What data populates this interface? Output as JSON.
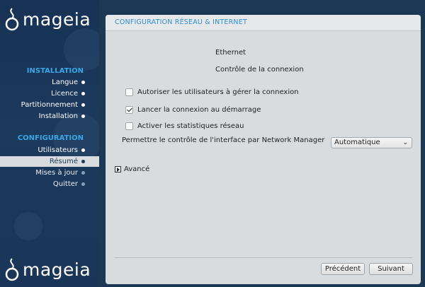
{
  "brand": {
    "name": "mageia"
  },
  "sidebar": {
    "installation_header": "INSTALLATION",
    "installation_items": [
      {
        "label": "Langue"
      },
      {
        "label": "Licence"
      },
      {
        "label": "Partitionnement"
      },
      {
        "label": "Installation"
      }
    ],
    "configuration_header": "CONFIGURATION",
    "configuration_items": [
      {
        "label": "Utilisateurs"
      },
      {
        "label": "Résumé",
        "current": true
      },
      {
        "label": "Mises à jour"
      },
      {
        "label": "Quitter"
      }
    ]
  },
  "panel": {
    "title": "CONFIGURATION RÉSEAU & INTERNET",
    "interface_name": "Ethernet",
    "section_label": "Contrôle de la connexion",
    "checkboxes": [
      {
        "label": "Autoriser les utilisateurs à gérer la connexion",
        "checked": false
      },
      {
        "label": "Lancer la connexion au démarrage",
        "checked": true
      },
      {
        "label": "Activer les statistiques réseau",
        "checked": false
      }
    ],
    "nm_label": "Permettre le contrôle de l'interface par Network Manager",
    "nm_select": {
      "value": "Automatique"
    },
    "advanced_label": "Avancé",
    "buttons": {
      "previous": "Précédent",
      "next": "Suivant"
    }
  },
  "colors": {
    "sidebar_bg": "#1c3a5c",
    "accent": "#39a6e6",
    "panel_bg": "#d9dcdf",
    "title_text": "#2f8fd0"
  }
}
